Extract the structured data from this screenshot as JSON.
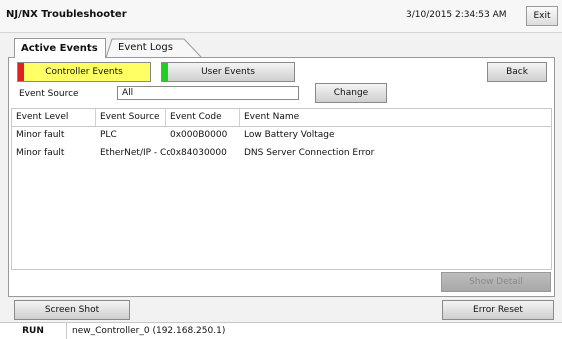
{
  "app": {
    "title": "NJ/NX Troubleshooter",
    "datetime": "3/10/2015 2:34:53 AM",
    "exit_label": "Exit"
  },
  "tabs": [
    {
      "label": "Active Events"
    },
    {
      "label": "Event Logs"
    }
  ],
  "filters": {
    "controller_events_label": "Controller Events",
    "controller_indicator_color": "#e02020",
    "user_events_label": "User Events",
    "user_indicator_color": "#22cc22",
    "back_label": "Back"
  },
  "source": {
    "label": "Event Source",
    "value": "All",
    "change_label": "Change"
  },
  "table": {
    "columns": [
      "Event Level",
      "Event Source",
      "Event Code",
      "Event Name"
    ],
    "rows": [
      [
        "Minor fault",
        "PLC",
        "0x000B0000",
        "Low Battery Voltage"
      ],
      [
        "Minor fault",
        "EtherNet/IP - Cc",
        "0x84030000",
        "DNS Server Connection Error"
      ]
    ]
  },
  "actions": {
    "show_detail_label": "Show Detail",
    "screenshot_label": "Screen Shot",
    "error_reset_label": "Error Reset"
  },
  "status": {
    "mode": "RUN",
    "controller": "new_Controller_0 (192.168.250.1)"
  }
}
